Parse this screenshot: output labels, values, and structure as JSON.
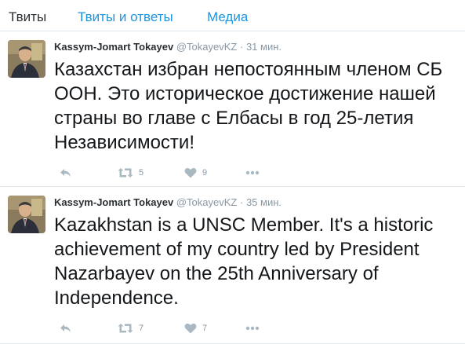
{
  "tabs": [
    {
      "label": "Твиты"
    },
    {
      "label": "Твиты и ответы"
    },
    {
      "label": "Медиа"
    }
  ],
  "tweets": [
    {
      "name": "Kassym-Jomart Tokayev",
      "handle": "@TokayevKZ",
      "separator": "·",
      "time": "31 мин.",
      "text": "Казахстан избран непостоянным членом СБ ООН. Это историческое достижение нашей страны во главе с Елбасы в год 25-летия Независимости!",
      "retweets": "5",
      "likes": "9"
    },
    {
      "name": "Kassym-Jomart Tokayev",
      "handle": "@TokayevKZ",
      "separator": "·",
      "time": "35 мин.",
      "text": "Kazakhstan is a UNSC Member. It's a historic achievement of my country led by President Nazarbayev on the 25th Anniversary of Independence.",
      "retweets": "7",
      "likes": "7"
    }
  ],
  "icons": {
    "reply": "reply-icon",
    "retweet": "retweet-icon",
    "like": "heart-icon",
    "more": "more-icon"
  },
  "colors": {
    "link": "#1b95e0",
    "muted": "#8899a6",
    "text": "#14171a",
    "border": "#e1e8ed"
  }
}
